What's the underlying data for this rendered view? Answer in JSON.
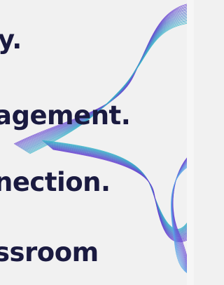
{
  "lines": [
    "y.",
    "agement.",
    "nection.",
    "ssroom"
  ],
  "colors": {
    "background": "#f1f1f1",
    "text": "#1a1a40",
    "wave_blue": "#5aa9e6",
    "wave_purple": "#6a3fd1",
    "wave_teal": "#39b6c9"
  }
}
